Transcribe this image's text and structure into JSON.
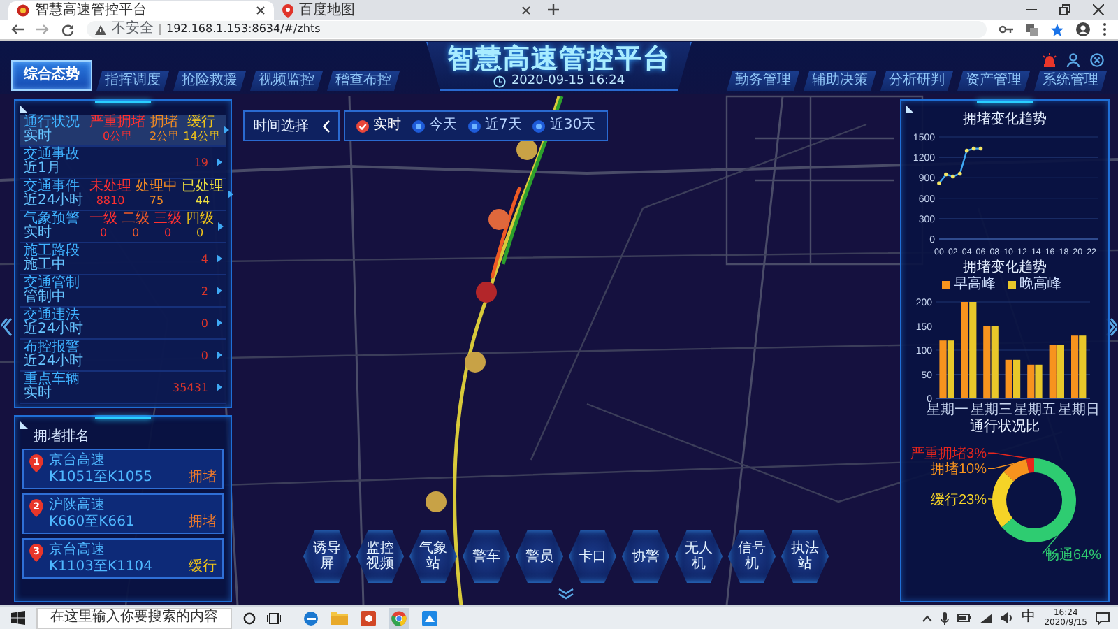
{
  "browser": {
    "tabs": [
      {
        "title": "智慧高速管控平台",
        "selected": true
      },
      {
        "title": "百度地图",
        "selected": false
      }
    ],
    "security": "不安全",
    "url": "192.168.1.153:8634/#/zhts"
  },
  "header": {
    "title": "智慧高速管控平台",
    "datetime": "2020-09-15 16:24",
    "nav_left": [
      {
        "label": "综合态势",
        "selected": true
      },
      {
        "label": "指挥调度",
        "selected": false
      },
      {
        "label": "抢险救援",
        "selected": false
      },
      {
        "label": "视频监控",
        "selected": false
      },
      {
        "label": "稽查布控",
        "selected": false
      }
    ],
    "nav_right": [
      {
        "label": "勤务管理",
        "selected": false
      },
      {
        "label": "辅助决策",
        "selected": false
      },
      {
        "label": "分析研判",
        "selected": false
      },
      {
        "label": "资产管理",
        "selected": false
      },
      {
        "label": "系统管理",
        "selected": false
      }
    ]
  },
  "status_panel": {
    "rows": [
      {
        "kind": "split",
        "title": "通行状况",
        "subtitle": "实时",
        "highlighted": true,
        "stats": [
          {
            "label": "严重拥堵",
            "value": "0公里",
            "color": "#ff3030"
          },
          {
            "label": "拥堵",
            "value": "2公里",
            "color": "#f08a24"
          },
          {
            "label": "缓行",
            "value": "14公里",
            "color": "#f0c419"
          }
        ]
      },
      {
        "kind": "single",
        "title": "交通事故",
        "subtitle": "近1月",
        "highlighted": false,
        "value": "19"
      },
      {
        "kind": "split",
        "title": "交通事件",
        "subtitle": "近24小时",
        "highlighted": false,
        "stats": [
          {
            "label": "未处理",
            "value": "8810",
            "color": "#ff3030"
          },
          {
            "label": "处理中",
            "value": "75",
            "color": "#f08a24"
          },
          {
            "label": "已处理",
            "value": "44",
            "color": "#f0e040"
          }
        ]
      },
      {
        "kind": "split",
        "title": "气象预警",
        "subtitle": "实时",
        "highlighted": false,
        "stats": [
          {
            "label": "一级",
            "value": "0",
            "color": "#ff3030"
          },
          {
            "label": "二级",
            "value": "0",
            "color": "#f05a28"
          },
          {
            "label": "三级",
            "value": "0",
            "color": "#ff3030"
          },
          {
            "label": "四级",
            "value": "0",
            "color": "#f0c419"
          }
        ]
      },
      {
        "kind": "single",
        "title": "施工路段",
        "subtitle": "施工中",
        "highlighted": false,
        "value": "4"
      },
      {
        "kind": "single",
        "title": "交通管制",
        "subtitle": "管制中",
        "highlighted": false,
        "value": "2"
      },
      {
        "kind": "single",
        "title": "交通违法",
        "subtitle": "近24小时",
        "highlighted": false,
        "value": "0"
      },
      {
        "kind": "single",
        "title": "布控报警",
        "subtitle": "近24小时",
        "highlighted": false,
        "value": "0"
      },
      {
        "kind": "single",
        "title": "重点车辆",
        "subtitle": "实时",
        "highlighted": false,
        "value": "35431"
      }
    ]
  },
  "time_filter": {
    "label": "时间选择",
    "options": [
      {
        "label": "实时",
        "selected": true
      },
      {
        "label": "今天",
        "selected": false
      },
      {
        "label": "近7天",
        "selected": false
      },
      {
        "label": "近30天",
        "selected": false
      }
    ]
  },
  "ranking": {
    "title": "拥堵排名",
    "items": [
      {
        "rank": "1",
        "road": "京台高速",
        "segment": "K1051至K1055",
        "status": "拥堵",
        "color": "#f07a2a"
      },
      {
        "rank": "2",
        "road": "沪陕高速",
        "segment": "K660至K661",
        "status": "拥堵",
        "color": "#f07a2a"
      },
      {
        "rank": "3",
        "road": "京台高速",
        "segment": "K1103至K1104",
        "status": "缓行",
        "color": "#f0c419"
      }
    ]
  },
  "map_tools": [
    "诱导屏",
    "监控视频",
    "气象站",
    "警车",
    "警员",
    "卡口",
    "协警",
    "无人机",
    "信号机",
    "执法站"
  ],
  "right_panel": {
    "charts": [
      {
        "chart_data": {
          "type": "line",
          "title": "拥堵变化趋势",
          "grid": true,
          "x": [
            0,
            1,
            2,
            3,
            4,
            5,
            6
          ],
          "xlim": [
            0,
            23
          ],
          "ylim": [
            0,
            1500
          ],
          "yticks": [
            0,
            300,
            600,
            900,
            1200,
            1500
          ],
          "xticks": [
            {
              "value": 0,
              "label": "00"
            },
            {
              "value": 2,
              "label": "02"
            },
            {
              "value": 4,
              "label": "04"
            },
            {
              "value": 6,
              "label": "06"
            },
            {
              "value": 8,
              "label": "08"
            },
            {
              "value": 10,
              "label": "10"
            },
            {
              "value": 12,
              "label": "12"
            },
            {
              "value": 14,
              "label": "14"
            },
            {
              "value": 16,
              "label": "16"
            },
            {
              "value": 18,
              "label": "18"
            },
            {
              "value": 20,
              "label": "20"
            },
            {
              "value": 22,
              "label": "22"
            }
          ],
          "series": [
            {
              "color": "#3fa9f5",
              "values": [
                820,
                950,
                920,
                960,
                1300,
                1330,
                1330
              ]
            }
          ]
        }
      },
      {
        "chart_data": {
          "type": "bar",
          "title": "拥堵变化趋势",
          "grid": true,
          "legend": "top",
          "categories": [
            "星期一",
            null,
            "星期三",
            null,
            "星期五",
            null,
            "星期日"
          ],
          "ylim": [
            0,
            200
          ],
          "yticks": [
            0,
            50,
            100,
            150,
            200
          ],
          "series": [
            {
              "name": "早高峰",
              "color": "#f7931e",
              "values": [
                120,
                200,
                150,
                80,
                70,
                110,
                130
              ]
            },
            {
              "name": "晚高峰",
              "color": "#e8c72a",
              "values": [
                120,
                200,
                150,
                80,
                70,
                110,
                130
              ]
            }
          ]
        }
      },
      {
        "chart_data": {
          "type": "donut",
          "title": "通行状况比",
          "categories": [
            "严重拥堵",
            "拥堵",
            "缓行",
            "畅通"
          ],
          "values": [
            3,
            10,
            23,
            64
          ],
          "colors": [
            "#e8261c",
            "#f7931e",
            "#f5d327",
            "#2ecc71"
          ],
          "value_labels": [
            "3%",
            "10%",
            "23%",
            "64%"
          ]
        }
      }
    ]
  },
  "taskbar": {
    "search_placeholder": "在这里输入你要搜索的内容",
    "ime": "中",
    "time": "16:24",
    "date": "2020/9/15"
  }
}
